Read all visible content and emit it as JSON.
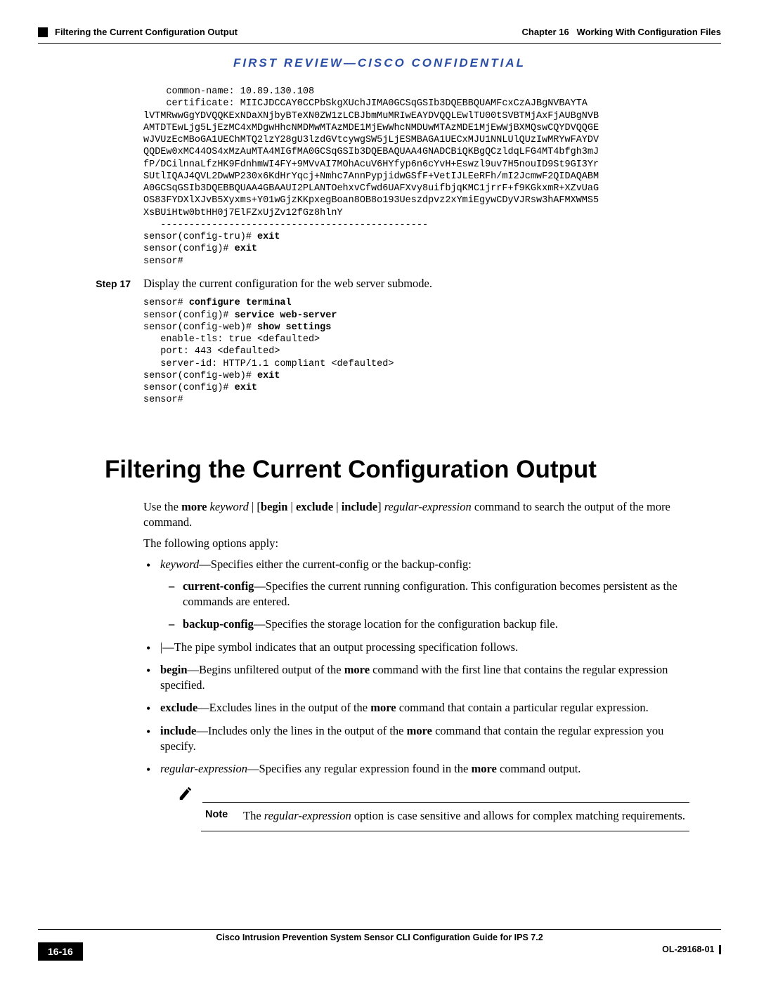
{
  "header": {
    "section_name": "Filtering the Current Configuration Output",
    "chapter_label": "Chapter 16",
    "chapter_title": "Working With Configuration Files"
  },
  "confidential_banner": "FIRST REVIEW—CISCO CONFIDENTIAL",
  "code_block_1": {
    "cert_indent": "    common-name: 10.89.130.108\n    certificate: MIICJDCCAY0CCPbSkgXUchJIMA0GCSqGSIb3DQEBBQUAMFcxCzAJBgNVBAYTA\nlVTMRwwGgYDVQQKExNDaXNjbyBTeXN0ZW1zLCBJbmMuMRIwEAYDVQQLEwlTU00tSVBTMjAxFjAUBgNVB\nAMTDTEwLjg5LjEzMC4xMDgwHhcNMDMwMTAzMDE1MjEwWhcNMDUwMTAzMDE1MjEwWjBXMQswCQYDVQQGE\nwJVUzEcMBoGA1UEChMTQ2lzY28gU3lzdGVtcywgSW5jLjESMBAGA1UECxMJU1NNLUlQUzIwMRYwFAYDV\nQQDEw0xMC44OS4xMzAuMTA4MIGfMA0GCSqGSIb3DQEBAQUAA4GNADCBiQKBgQCzldqLFG4MT4bfgh3mJ\nfP/DCilnnaLfzHK9FdnhmWI4FY+9MVvAI7MOhAcuV6HYfyp6n6cYvH+Eswzl9uv7H5nouID9St9GI3Yr\nSUtlIQAJ4QVL2DwWP230x6KdHrYqcj+Nmhc7AnnPypjidwGSfF+VetIJLEeRFh/mI2JcmwF2QIDAQABM\nA0GCSqGSIb3DQEBBQUAA4GBAAUI2PLANTOehxvCfwd6UAFXvy8uifbjqKMC1jrrF+f9KGkxmR+XZvUaG\nOS83FYDXlXJvB5Xyxms+Y01wGjzKKpxegBoan8OB8o193Ueszdpvz2xYmiEgywCDyVJRsw3hAFMXWMS5\nXsBUiHtw0btHH0j7ElFZxUjZv12fGz8hlnY\n   -----------------------------------------------",
    "exit_lines": "sensor(config-tru)# <b>exit</b>\nsensor(config)# <b>exit</b>\nsensor#"
  },
  "step17": {
    "label": "Step 17",
    "text": "Display the current configuration for the web server submode."
  },
  "code_block_2": "sensor# <b>configure terminal</b>\nsensor(config)# <b>service web-server</b>\nsensor(config-web)# <b>show settings</b>\n   enable-tls: true <defaulted>\n   port: 443 <defaulted>\n   server-id: HTTP/1.1 compliant <defaulted>\nsensor(config-web)# <b>exit</b>\nsensor(config)# <b>exit</b>\nsensor#",
  "section": {
    "heading": "Filtering the Current Configuration Output",
    "intro_html": "Use the <b>more</b> <i>keyword</i> | [<b>begin</b> | <b>exclude</b> | <b>include</b>] <i>regular-expression</i> command to search the output of the more command.",
    "apply_intro": "The following options apply:",
    "bullets": [
      {
        "html": "<i>keyword</i>—Specifies either the current-config or the backup-config:",
        "sub": [
          "<b>current-config</b>—Specifies the current running configuration. This configuration becomes persistent as the commands are entered.",
          "<b>backup-config</b>—Specifies the storage location for the configuration backup file."
        ]
      },
      {
        "html": "|—The pipe symbol indicates that an output processing specification follows."
      },
      {
        "html": "<b>begin</b>—Begins unfiltered output of the <b>more</b> command with the first line that contains the regular expression specified."
      },
      {
        "html": "<b>exclude</b>—Excludes lines in the output of the <b>more</b> command that contain a particular regular expression."
      },
      {
        "html": "<b>include</b>—Includes only the lines in the output of the <b>more</b> command that contain the regular expression you specify."
      },
      {
        "html": "<i>regular-expression</i>—Specifies any regular expression found in the <b>more</b> command output."
      }
    ],
    "note": {
      "label": "Note",
      "html": "The <i>regular-expression</i> option is case sensitive and allows for complex matching requirements."
    }
  },
  "footer": {
    "book_title": "Cisco Intrusion Prevention System Sensor CLI Configuration Guide for IPS 7.2",
    "page_number": "16-16",
    "doc_number": "OL-29168-01"
  }
}
